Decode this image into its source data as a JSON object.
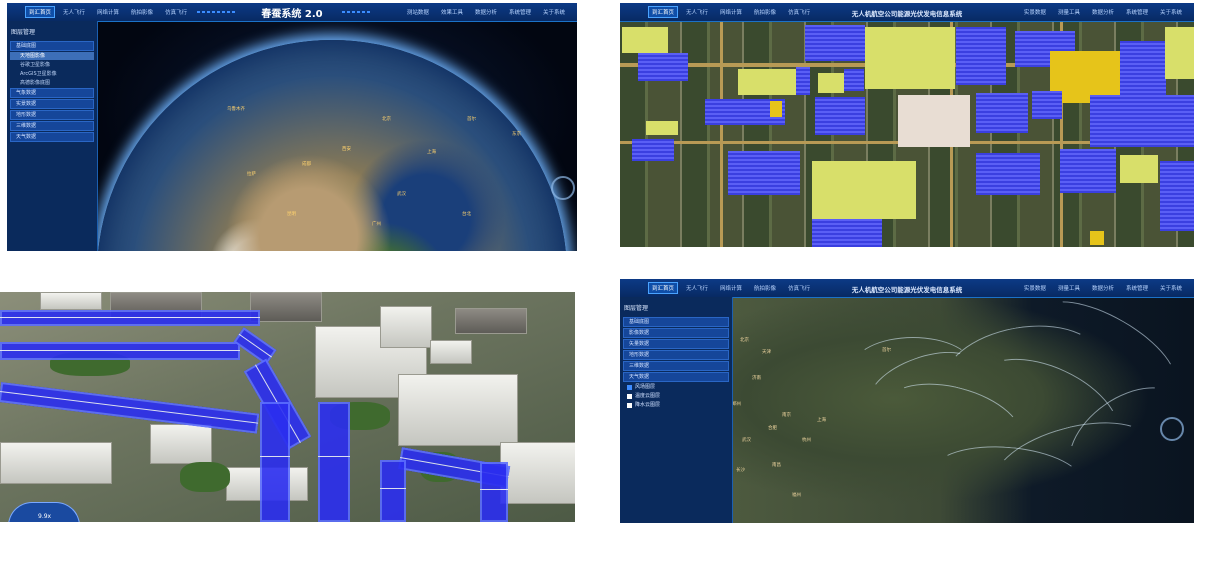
{
  "panel1": {
    "title": "春蚕系统 2.0",
    "nav_left": [
      "到汇首页",
      "无人飞行",
      "网络计算",
      "航拍影像",
      "仿真飞行"
    ],
    "nav_right": [
      "测站数据",
      "效果工具",
      "数据分析",
      "系统管理",
      "关于系统"
    ],
    "sidebar_title": "图层管理",
    "sidebar_items": [
      {
        "label": "基础底图",
        "type": "section"
      },
      {
        "label": "天地图影像",
        "type": "sub",
        "selected": true
      },
      {
        "label": "谷歌卫星影像",
        "type": "sub"
      },
      {
        "label": "ArcGIS卫星影像",
        "type": "sub"
      },
      {
        "label": "高德影像底图",
        "type": "sub"
      },
      {
        "label": "气象数据",
        "type": "section"
      },
      {
        "label": "实景数据",
        "type": "section"
      },
      {
        "label": "地形数据",
        "type": "section"
      },
      {
        "label": "三维数据",
        "type": "section"
      },
      {
        "label": "天气数据",
        "type": "section"
      }
    ],
    "cities": [
      "上海",
      "北京",
      "西安",
      "成都",
      "广州",
      "台北",
      "首尔",
      "东京",
      "乌鲁木齐",
      "拉萨",
      "昆明",
      "武汉"
    ]
  },
  "panel2": {
    "title": "无人机航空公司能源光伏发电信息系统",
    "nav_left": [
      "到汇首页",
      "无人飞行",
      "网络计算",
      "航拍影像",
      "仿真飞行"
    ],
    "nav_right": [
      "实景数据",
      "测量工具",
      "数据分析",
      "系统管理",
      "关于系统"
    ]
  },
  "panel3": {
    "speed": "9.9x"
  },
  "panel4": {
    "title": "无人机航空公司能源光伏发电信息系统",
    "nav_left": [
      "到汇首页",
      "无人飞行",
      "网络计算",
      "航拍影像",
      "仿真飞行"
    ],
    "nav_right": [
      "实景数据",
      "测量工具",
      "数据分析",
      "系统管理",
      "关于系统"
    ],
    "sidebar_title": "图层管理",
    "sidebar_items": [
      {
        "label": "基础底图",
        "type": "section"
      },
      {
        "label": "影像数据",
        "type": "section"
      },
      {
        "label": "矢量数据",
        "type": "section"
      },
      {
        "label": "地形数据",
        "type": "section"
      },
      {
        "label": "三维数据",
        "type": "section"
      },
      {
        "label": "天气数据",
        "type": "section"
      }
    ],
    "checkboxes": [
      {
        "label": "风场图层",
        "checked": true
      },
      {
        "label": "温度云图层",
        "checked": false
      },
      {
        "label": "降水云图层",
        "checked": false
      }
    ],
    "cities": [
      "北京",
      "天津",
      "济南",
      "郑州",
      "南京",
      "上海",
      "杭州",
      "合肥",
      "武汉",
      "长沙",
      "南昌",
      "福州",
      "首尔"
    ]
  },
  "colors": {
    "header_bg": "#0c3a86",
    "accent": "#3b8cff",
    "solar_blue": "#3a3fe0",
    "solar_yellow": "#d8df6a",
    "pipe_blue": "#2b2ef0"
  }
}
